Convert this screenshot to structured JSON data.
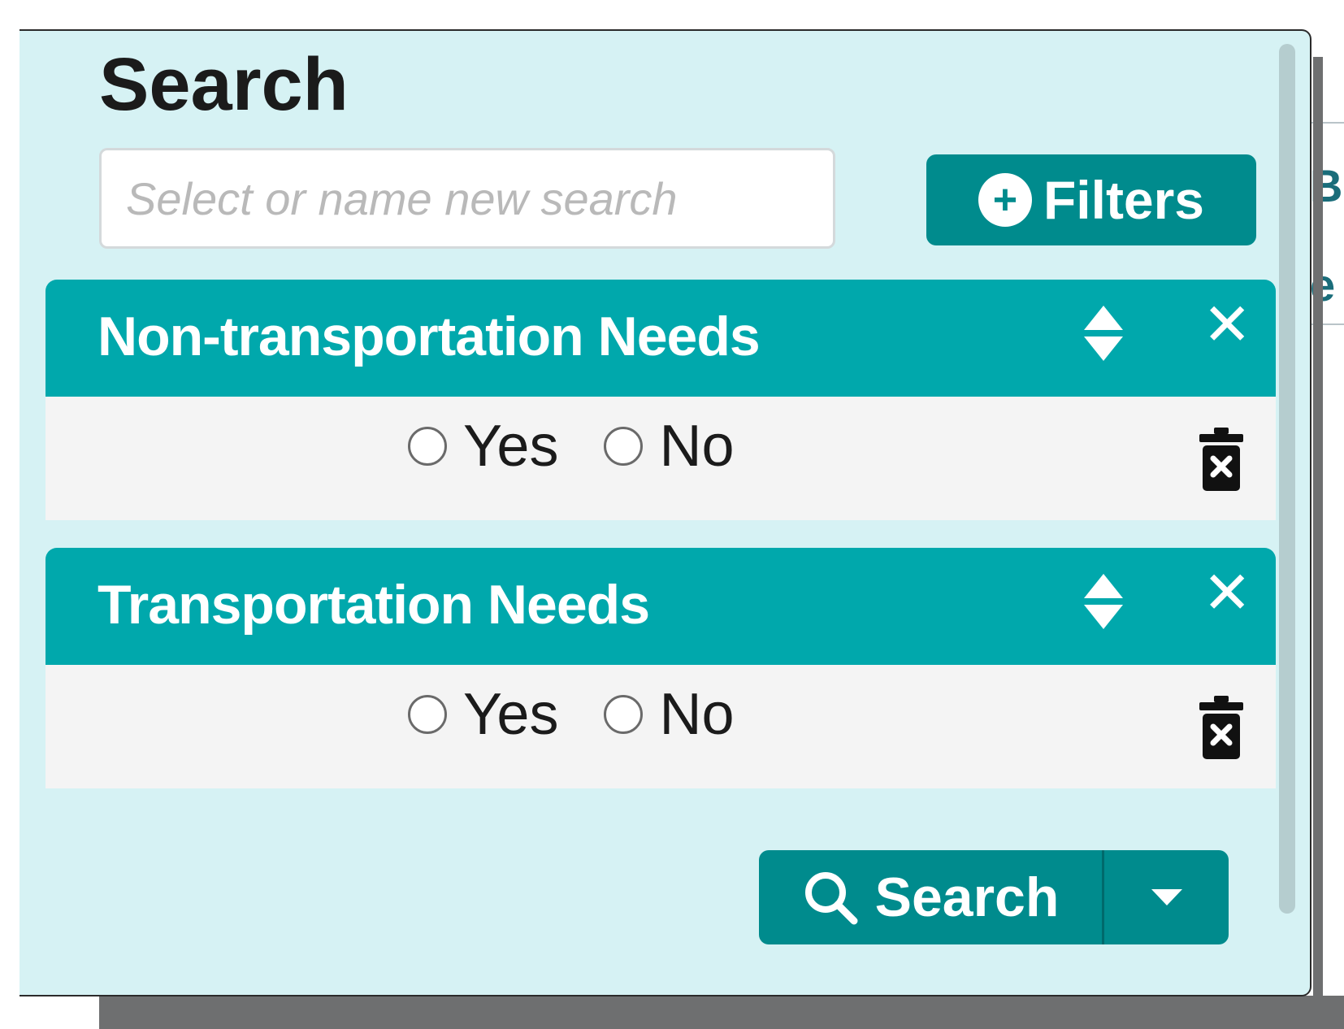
{
  "panel": {
    "title": "Search",
    "search_input": {
      "placeholder": "Select or name new search",
      "value": ""
    },
    "filters_button": {
      "label": "Filters",
      "icon": "plus-circle-icon"
    },
    "filter_blocks": [
      {
        "title": "Non-transportation Needs",
        "options": [
          "Yes",
          "No"
        ],
        "selected": null
      },
      {
        "title": "Transportation Needs",
        "options": [
          "Yes",
          "No"
        ],
        "selected": null
      }
    ],
    "search_button": {
      "label": "Search",
      "icon": "magnifier-icon"
    }
  },
  "colors": {
    "panel_bg": "#d6f2f4",
    "accent": "#00a8ac",
    "button": "#008b8d",
    "body_bg": "#f4f4f4"
  }
}
